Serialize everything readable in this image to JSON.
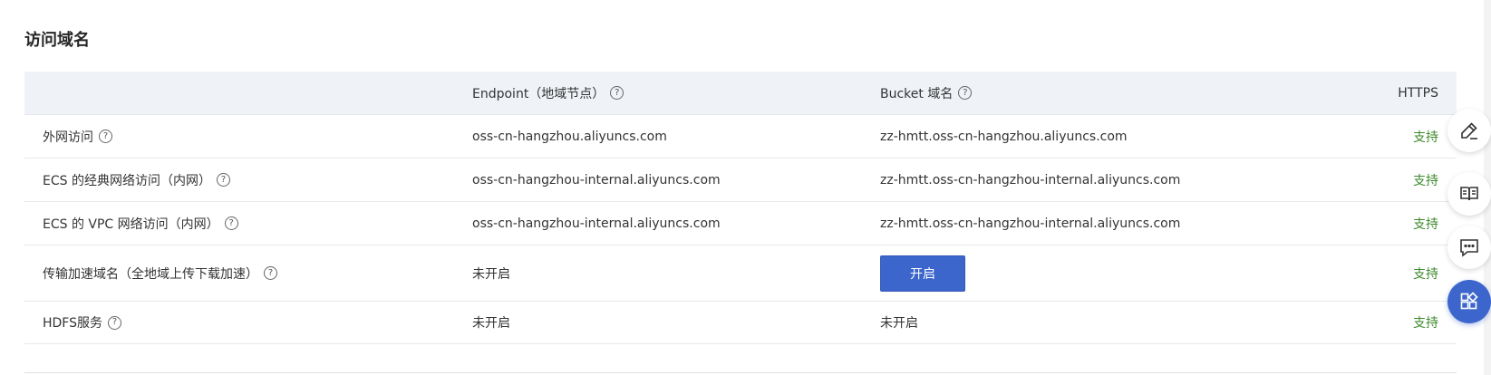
{
  "section": {
    "title": "访问域名"
  },
  "table": {
    "headers": {
      "endpoint": "Endpoint（地域节点）",
      "bucket": "Bucket 域名",
      "https": "HTTPS"
    },
    "rows": [
      {
        "label": "外网访问",
        "endpoint": "oss-cn-hangzhou.aliyuncs.com",
        "bucket": "zz-hmtt.oss-cn-hangzhou.aliyuncs.com",
        "https": "支持"
      },
      {
        "label": "ECS 的经典网络访问（内网）",
        "endpoint": "oss-cn-hangzhou-internal.aliyuncs.com",
        "bucket": "zz-hmtt.oss-cn-hangzhou-internal.aliyuncs.com",
        "https": "支持"
      },
      {
        "label": "ECS 的 VPC 网络访问（内网）",
        "endpoint": "oss-cn-hangzhou-internal.aliyuncs.com",
        "bucket": "zz-hmtt.oss-cn-hangzhou-internal.aliyuncs.com",
        "https": "支持"
      },
      {
        "label": "传输加速域名（全地域上传下载加速）",
        "endpoint": "未开启",
        "bucket_button": "开启",
        "https": "支持"
      },
      {
        "label": "HDFS服务",
        "endpoint": "未开启",
        "bucket": "未开启",
        "https": "支持"
      }
    ]
  },
  "help_glyph": "?",
  "floating_tools": [
    {
      "icon": "edit-icon"
    },
    {
      "icon": "book-icon"
    },
    {
      "icon": "chat-icon"
    },
    {
      "icon": "apps-icon"
    }
  ],
  "colors": {
    "header_bg": "#eff3f8",
    "support_green": "#3e8a2c",
    "primary_blue": "#3d66cc"
  }
}
